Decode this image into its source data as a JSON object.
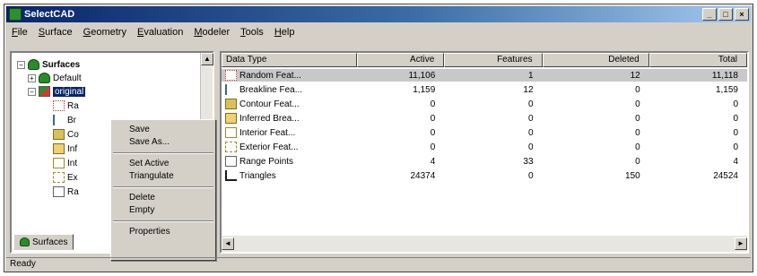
{
  "window": {
    "title": "SelectCAD",
    "controls": {
      "minimize": "_",
      "maximize": "□",
      "close": "×"
    }
  },
  "menu": [
    "File",
    "Surface",
    "Geometry",
    "Evaluation",
    "Modeler",
    "Tools",
    "Help"
  ],
  "tree": {
    "root": "Surfaces",
    "items": [
      "Default",
      "original",
      "Ra",
      "Br",
      "Co",
      "Inf",
      "Int",
      "Ex",
      "Ra"
    ]
  },
  "tabs": {
    "surfaces": "Surfaces"
  },
  "context_menu": {
    "items": [
      "Save",
      "Save As...",
      "Set Active",
      "Triangulate",
      "Delete",
      "Empty",
      "Properties"
    ]
  },
  "table": {
    "headers": [
      "Data Type",
      "Active",
      "Features",
      "Deleted",
      "Total"
    ],
    "rows": [
      {
        "type": "Random Feat...",
        "active": "11,106",
        "features": "1",
        "deleted": "12",
        "total": "11,118"
      },
      {
        "type": "Breakline Fea...",
        "active": "1,159",
        "features": "12",
        "deleted": "0",
        "total": "1,159"
      },
      {
        "type": "Contour Feat...",
        "active": "0",
        "features": "0",
        "deleted": "0",
        "total": "0"
      },
      {
        "type": "Inferred Brea...",
        "active": "0",
        "features": "0",
        "deleted": "0",
        "total": "0"
      },
      {
        "type": "Interior Feat...",
        "active": "0",
        "features": "0",
        "deleted": "0",
        "total": "0"
      },
      {
        "type": "Exterior Feat...",
        "active": "0",
        "features": "0",
        "deleted": "0",
        "total": "0"
      },
      {
        "type": "Range Points",
        "active": "4",
        "features": "33",
        "deleted": "0",
        "total": "4"
      },
      {
        "type": "Triangles",
        "active": "24374",
        "features": "0",
        "deleted": "150",
        "total": "24524"
      }
    ]
  },
  "status": "Ready"
}
